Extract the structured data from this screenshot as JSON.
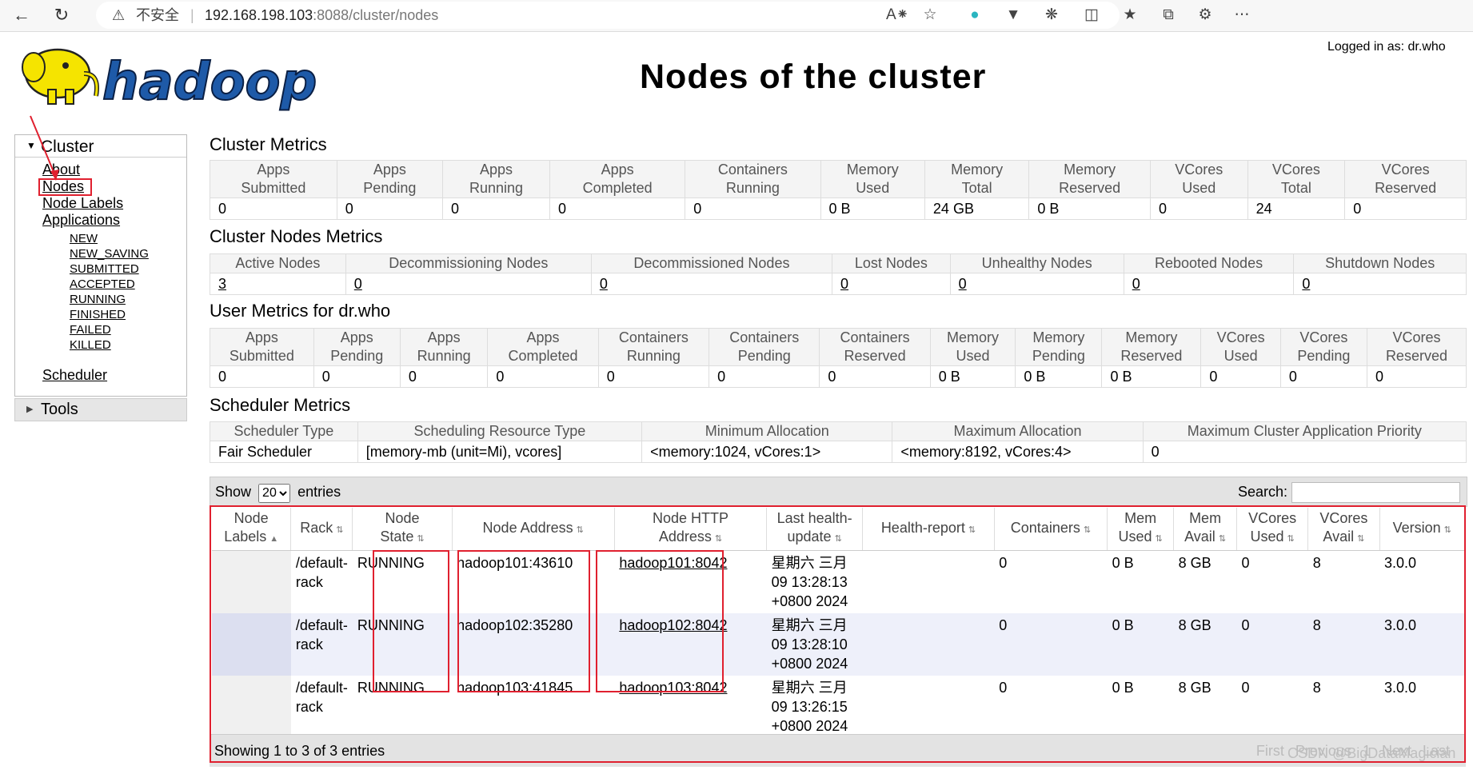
{
  "browser": {
    "insecure_label": "不安全",
    "url_host": "192.168.198.103",
    "url_rest": ":8088/cluster/nodes"
  },
  "header": {
    "logged_in": "Logged in as: dr.who",
    "logo_text": "hadoop",
    "title": "Nodes of the cluster"
  },
  "sidebar": {
    "cluster_label": "Cluster",
    "links": [
      "About",
      "Nodes",
      "Node Labels",
      "Applications"
    ],
    "app_states": [
      "NEW",
      "NEW_SAVING",
      "SUBMITTED",
      "ACCEPTED",
      "RUNNING",
      "FINISHED",
      "FAILED",
      "KILLED"
    ],
    "scheduler": "Scheduler",
    "tools": "Tools"
  },
  "cluster_metrics": {
    "title": "Cluster Metrics",
    "headers": [
      [
        "Apps",
        "Submitted"
      ],
      [
        "Apps",
        "Pending"
      ],
      [
        "Apps",
        "Running"
      ],
      [
        "Apps",
        "Completed"
      ],
      [
        "Containers",
        "Running"
      ],
      [
        "Memory",
        "Used"
      ],
      [
        "Memory",
        "Total"
      ],
      [
        "Memory",
        "Reserved"
      ],
      [
        "VCores",
        "Used"
      ],
      [
        "VCores",
        "Total"
      ],
      [
        "VCores",
        "Reserved"
      ]
    ],
    "values": [
      "0",
      "0",
      "0",
      "0",
      "0",
      "0 B",
      "24 GB",
      "0 B",
      "0",
      "24",
      "0"
    ]
  },
  "cluster_nodes_metrics": {
    "title": "Cluster Nodes Metrics",
    "headers": [
      "Active Nodes",
      "Decommissioning Nodes",
      "Decommissioned Nodes",
      "Lost Nodes",
      "Unhealthy Nodes",
      "Rebooted Nodes",
      "Shutdown Nodes"
    ],
    "values": [
      "3",
      "0",
      "0",
      "0",
      "0",
      "0",
      "0"
    ]
  },
  "user_metrics": {
    "title": "User Metrics for dr.who",
    "headers": [
      [
        "Apps",
        "Submitted"
      ],
      [
        "Apps",
        "Pending"
      ],
      [
        "Apps",
        "Running"
      ],
      [
        "Apps",
        "Completed"
      ],
      [
        "Containers",
        "Running"
      ],
      [
        "Containers",
        "Pending"
      ],
      [
        "Containers",
        "Reserved"
      ],
      [
        "Memory",
        "Used"
      ],
      [
        "Memory",
        "Pending"
      ],
      [
        "Memory",
        "Reserved"
      ],
      [
        "VCores",
        "Used"
      ],
      [
        "VCores",
        "Pending"
      ],
      [
        "VCores",
        "Reserved"
      ]
    ],
    "values": [
      "0",
      "0",
      "0",
      "0",
      "0",
      "0",
      "0",
      "0 B",
      "0 B",
      "0 B",
      "0",
      "0",
      "0"
    ]
  },
  "scheduler_metrics": {
    "title": "Scheduler Metrics",
    "headers": [
      "Scheduler Type",
      "Scheduling Resource Type",
      "Minimum Allocation",
      "Maximum Allocation",
      "Maximum Cluster Application Priority"
    ],
    "values": [
      "Fair Scheduler",
      "[memory-mb (unit=Mi), vcores]",
      "<memory:1024, vCores:1>",
      "<memory:8192, vCores:4>",
      "0"
    ]
  },
  "nodes_table": {
    "show_label": "Show",
    "entries_label": "entries",
    "page_size": "20",
    "search_label": "Search:",
    "headers": [
      [
        "Node",
        "Labels"
      ],
      [
        "Rack"
      ],
      [
        "Node",
        "State"
      ],
      [
        "Node Address"
      ],
      [
        "Node HTTP",
        "Address"
      ],
      [
        "Last health-",
        "update"
      ],
      [
        "Health-report"
      ],
      [
        "Containers"
      ],
      [
        "Mem",
        "Used"
      ],
      [
        "Mem",
        "Avail"
      ],
      [
        "VCores",
        "Used"
      ],
      [
        "VCores",
        "Avail"
      ],
      [
        "Version"
      ]
    ],
    "rows": [
      {
        "labels": "",
        "rack": "/default-rack",
        "state": "RUNNING",
        "address": "hadoop101:43610",
        "http": "hadoop101:8042",
        "health_update": "星期六 三月 09 13:28:13 +0800 2024",
        "report": "",
        "containers": "0",
        "mem_used": "0 B",
        "mem_avail": "8 GB",
        "vc_used": "0",
        "vc_avail": "8",
        "version": "3.0.0"
      },
      {
        "labels": "",
        "rack": "/default-rack",
        "state": "RUNNING",
        "address": "hadoop102:35280",
        "http": "hadoop102:8042",
        "health_update": "星期六 三月 09 13:28:10 +0800 2024",
        "report": "",
        "containers": "0",
        "mem_used": "0 B",
        "mem_avail": "8 GB",
        "vc_used": "0",
        "vc_avail": "8",
        "version": "3.0.0"
      },
      {
        "labels": "",
        "rack": "/default-rack",
        "state": "RUNNING",
        "address": "hadoop103:41845",
        "http": "hadoop103:8042",
        "health_update": "星期六 三月 09 13:26:15 +0800 2024",
        "report": "",
        "containers": "0",
        "mem_used": "0 B",
        "mem_avail": "8 GB",
        "vc_used": "0",
        "vc_avail": "8",
        "version": "3.0.0"
      }
    ],
    "info": "Showing 1 to 3 of 3 entries",
    "pager": [
      "First",
      "Previous",
      "1",
      "Next",
      "Last"
    ]
  },
  "watermark": "CSDN @BigDataMagician",
  "colors": {
    "highlight": "#e0202f",
    "logo_yellow": "#f5e400",
    "logo_blue": "#1e5aa8"
  },
  "icons": [
    "back-icon",
    "refresh-icon",
    "warning-icon",
    "read-aloud-icon",
    "favorite-icon",
    "extension-icon",
    "split-screen-icon",
    "favorites-list-icon",
    "collections-icon",
    "performance-icon"
  ]
}
